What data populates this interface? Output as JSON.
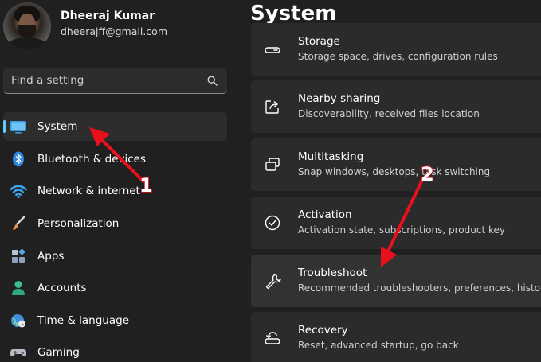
{
  "profile": {
    "name": "Dheeraj Kumar",
    "email": "dheerajff@gmail.com"
  },
  "search": {
    "placeholder": "Find a setting",
    "icon": "search-icon"
  },
  "sidebar": {
    "items": [
      {
        "label": "System",
        "icon": "monitor-icon",
        "active": true
      },
      {
        "label": "Bluetooth & devices",
        "icon": "bluetooth-icon"
      },
      {
        "label": "Network & internet",
        "icon": "wifi-icon"
      },
      {
        "label": "Personalization",
        "icon": "paintbrush-icon"
      },
      {
        "label": "Apps",
        "icon": "apps-icon"
      },
      {
        "label": "Accounts",
        "icon": "person-icon"
      },
      {
        "label": "Time & language",
        "icon": "globe-clock-icon"
      },
      {
        "label": "Gaming",
        "icon": "gamepad-icon"
      }
    ]
  },
  "main": {
    "title": "System",
    "cards": [
      {
        "title": "Storage",
        "desc": "Storage space, drives, configuration rules",
        "icon": "storage-drive-icon"
      },
      {
        "title": "Nearby sharing",
        "desc": "Discoverability, received files location",
        "icon": "share-icon"
      },
      {
        "title": "Multitasking",
        "desc": "Snap windows, desktops, task switching",
        "icon": "multitasking-icon"
      },
      {
        "title": "Activation",
        "desc": "Activation state, subscriptions, product key",
        "icon": "checkmark-circle-icon"
      },
      {
        "title": "Troubleshoot",
        "desc": "Recommended troubleshooters, preferences, history",
        "icon": "wrench-icon"
      },
      {
        "title": "Recovery",
        "desc": "Reset, advanced startup, go back",
        "icon": "recovery-icon"
      }
    ]
  },
  "annotations": {
    "marker_1": "1",
    "marker_2": "2",
    "arrow_color": "#e8101a"
  },
  "colors": {
    "background": "#202020",
    "card": "#2b2b2b",
    "accent": "#60cdff"
  }
}
